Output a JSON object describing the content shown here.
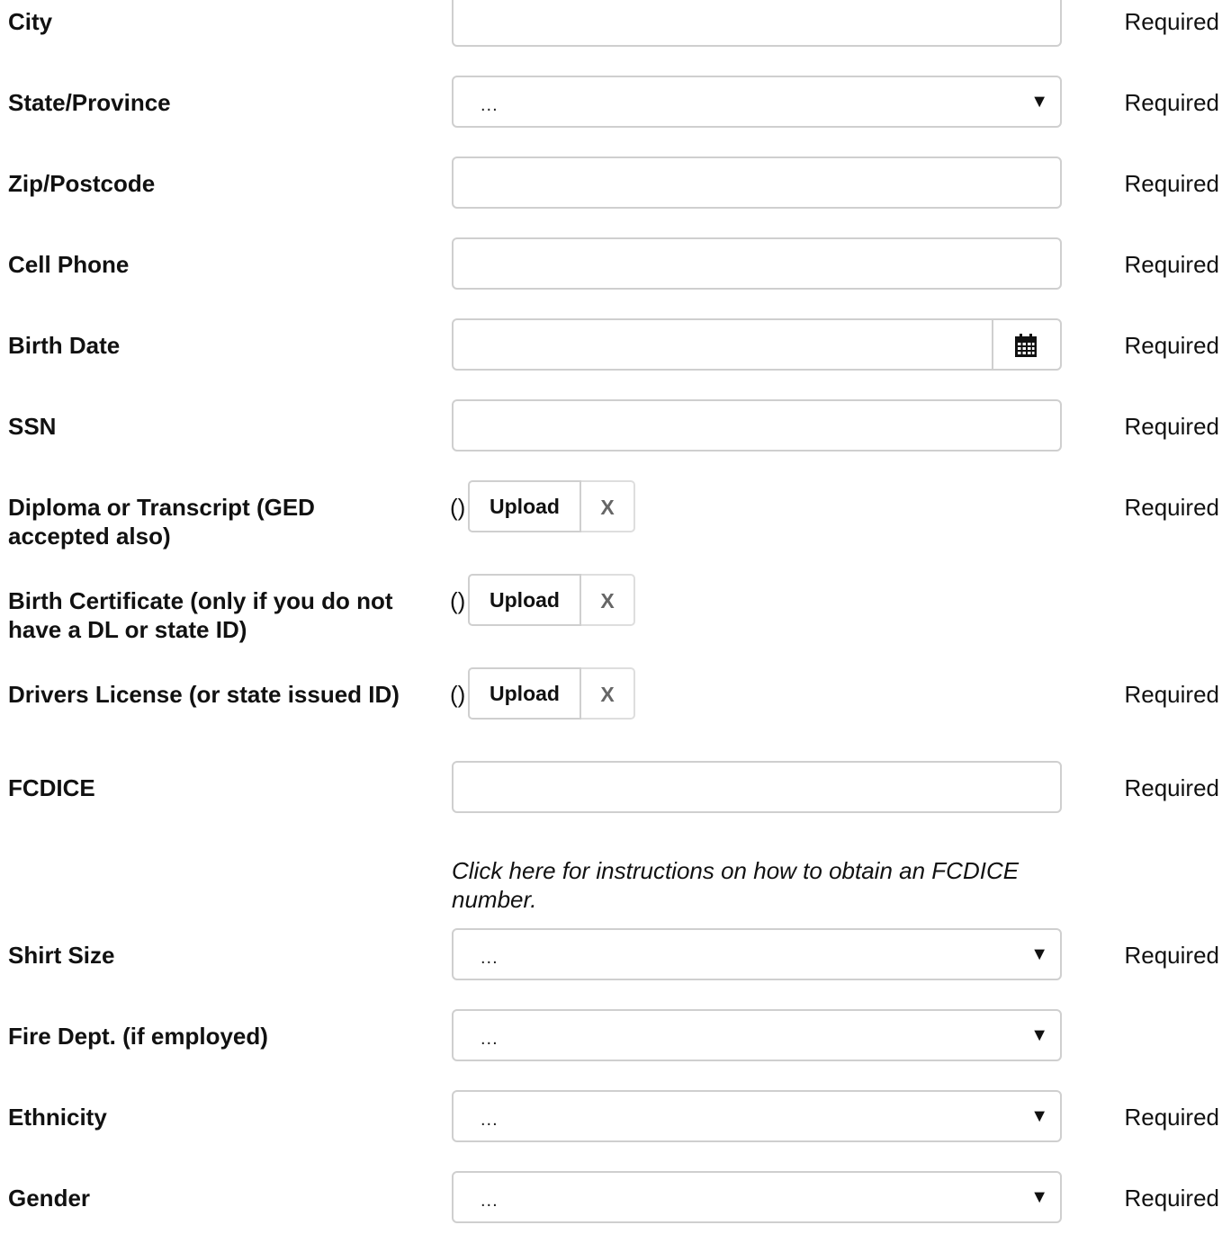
{
  "fields": {
    "city": {
      "label": "City",
      "required": "Required"
    },
    "state": {
      "label": "State/Province",
      "required": "Required",
      "selected": "...",
      "arrow": "▼"
    },
    "zip": {
      "label": "Zip/Postcode",
      "required": "Required"
    },
    "cell": {
      "label": "Cell Phone",
      "required": "Required"
    },
    "birth_date": {
      "label": "Birth Date",
      "required": "Required",
      "icon": "calendar-icon"
    },
    "ssn": {
      "label": "SSN",
      "required": "Required"
    },
    "diploma": {
      "label": "Diploma or Transcript (GED accepted also)",
      "required": "Required",
      "paren": "()",
      "upload": "Upload",
      "clear": "X"
    },
    "birth_cert": {
      "label": "Birth Certificate (only if you do not have a DL or state ID)",
      "paren": "()",
      "upload": "Upload",
      "clear": "X"
    },
    "drivers_license": {
      "label": "Drivers License (or state issued ID)",
      "required": "Required",
      "paren": "()",
      "upload": "Upload",
      "clear": "X"
    },
    "fcdice": {
      "label": "FCDICE",
      "required": "Required",
      "help": "Click here for instructions on how to obtain an FCDICE number."
    },
    "shirt": {
      "label": "Shirt Size",
      "required": "Required",
      "selected": "...",
      "arrow": "▼"
    },
    "fire_dept": {
      "label": "Fire Dept. (if employed)",
      "selected": "...",
      "arrow": "▼"
    },
    "ethnicity": {
      "label": "Ethnicity",
      "required": "Required",
      "selected": "...",
      "arrow": "▼"
    },
    "gender": {
      "label": "Gender",
      "required": "Required",
      "selected": "...",
      "arrow": "▼"
    }
  },
  "colors": {
    "border": "#cfcfcf",
    "text": "#111111",
    "muted": "#666666"
  }
}
